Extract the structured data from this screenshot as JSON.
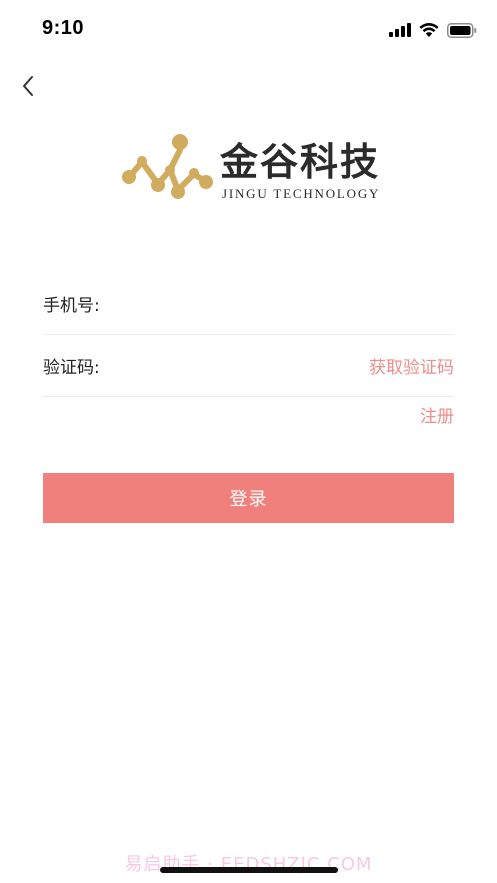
{
  "status_bar": {
    "time": "9:10"
  },
  "brand": {
    "name": "金谷科技",
    "subtitle": "JINGU TECHNOLOGY",
    "logo_color": "#d1ac5f"
  },
  "form": {
    "phone_label": "手机号:",
    "phone_value": "",
    "code_label": "验证码:",
    "code_value": "",
    "get_code_label": "获取验证码",
    "register_label": "注册"
  },
  "login_button": {
    "label": "登录"
  },
  "watermark": {
    "text": "易启助手 · EEDSHZJC.COM"
  },
  "colors": {
    "accent": "#f0807c",
    "link": "#ef8d89",
    "brand_gold": "#d1ac5f",
    "divider": "#ececec"
  }
}
